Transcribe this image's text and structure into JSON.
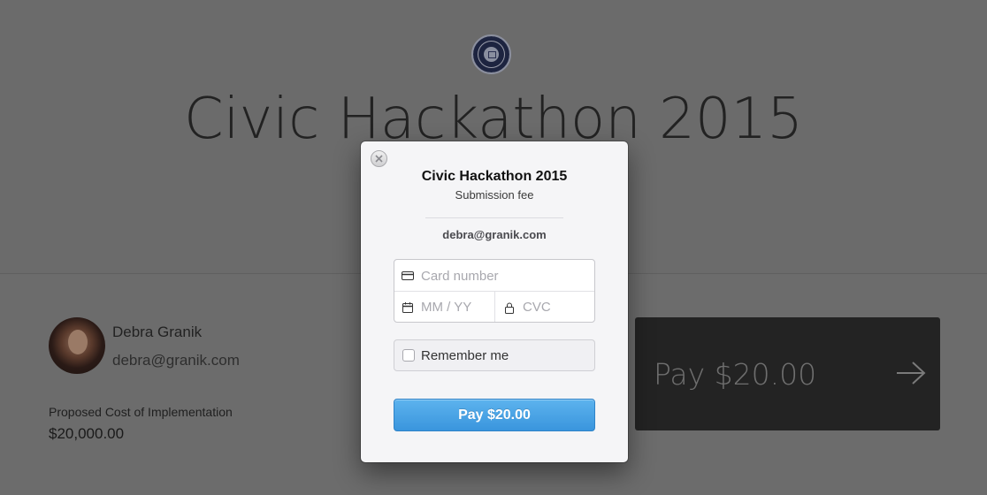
{
  "page": {
    "title": "Civic Hackathon 2015",
    "user": {
      "name": "Debra Granik",
      "email": "debra@granik.com"
    },
    "cost": {
      "label": "Proposed Cost of Implementation",
      "value": "$20,000.00"
    },
    "pay_button_label": "Pay $20.00"
  },
  "modal": {
    "title": "Civic Hackathon 2015",
    "subtitle": "Submission fee",
    "email": "debra@granik.com",
    "card_number_placeholder": "Card number",
    "expiry_placeholder": "MM / YY",
    "cvc_placeholder": "CVC",
    "remember_label": "Remember me",
    "pay_label": "Pay $20.00",
    "accent_color": "#3a95dd"
  },
  "icons": [
    "seal-logo-icon",
    "close-icon",
    "credit-card-icon",
    "calendar-icon",
    "lock-icon",
    "arrow-right-icon"
  ]
}
